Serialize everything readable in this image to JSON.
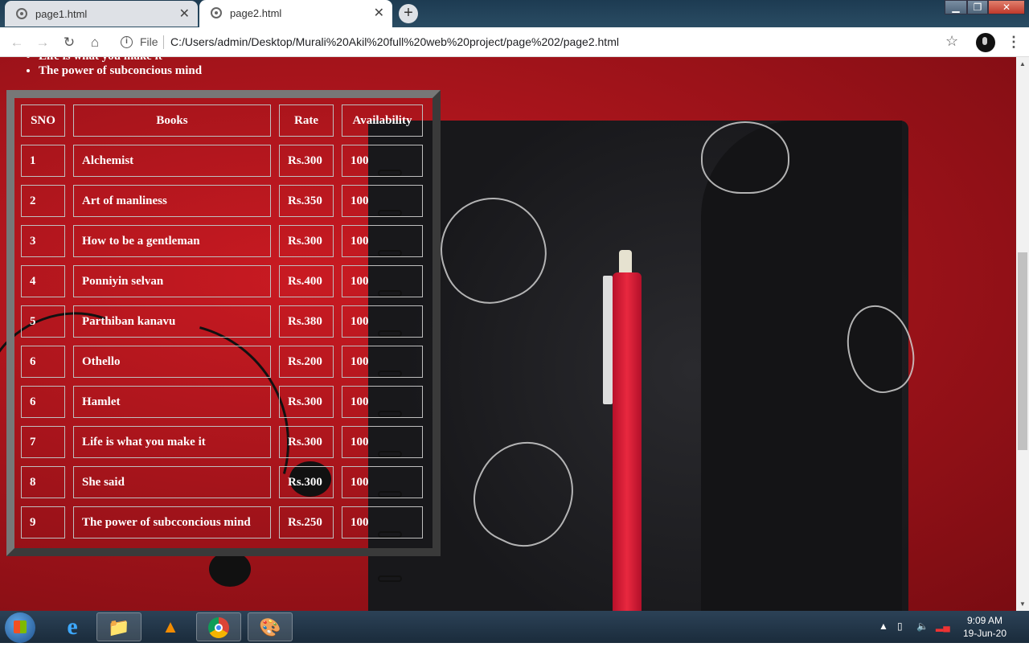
{
  "browser": {
    "tabs": [
      {
        "title": "page1.html",
        "close": "✕"
      },
      {
        "title": "page2.html",
        "close": "✕"
      }
    ],
    "new_tab": "+",
    "security_label": "File",
    "url": "C:/Users/admin/Desktop/Murali%20Akil%20full%20web%20project/page%202/page2.html"
  },
  "page": {
    "list_items": [
      "Life is what you make it",
      "The power of subconcious mind"
    ],
    "table": {
      "headers": [
        "SNO",
        "Books",
        "Rate",
        "Availability"
      ],
      "rows": [
        [
          "1",
          "Alchemist",
          "Rs.300",
          "100"
        ],
        [
          "2",
          "Art of manliness",
          "Rs.350",
          "100"
        ],
        [
          "3",
          "How to be a gentleman",
          "Rs.300",
          "100"
        ],
        [
          "4",
          "Ponniyin selvan",
          "Rs.400",
          "100"
        ],
        [
          "5",
          "Parthiban kanavu",
          "Rs.380",
          "100"
        ],
        [
          "6",
          "Othello",
          "Rs.200",
          "100"
        ],
        [
          "6",
          "Hamlet",
          "Rs.300",
          "100"
        ],
        [
          "7",
          "Life is what you make it",
          "Rs.300",
          "100"
        ],
        [
          "8",
          "She said",
          "Rs.300",
          "100"
        ],
        [
          "9",
          "The power of subcconcious mind",
          "Rs.250",
          "100"
        ]
      ]
    }
  },
  "taskbar": {
    "time": "9:09 AM",
    "date": "19-Jun-20"
  }
}
